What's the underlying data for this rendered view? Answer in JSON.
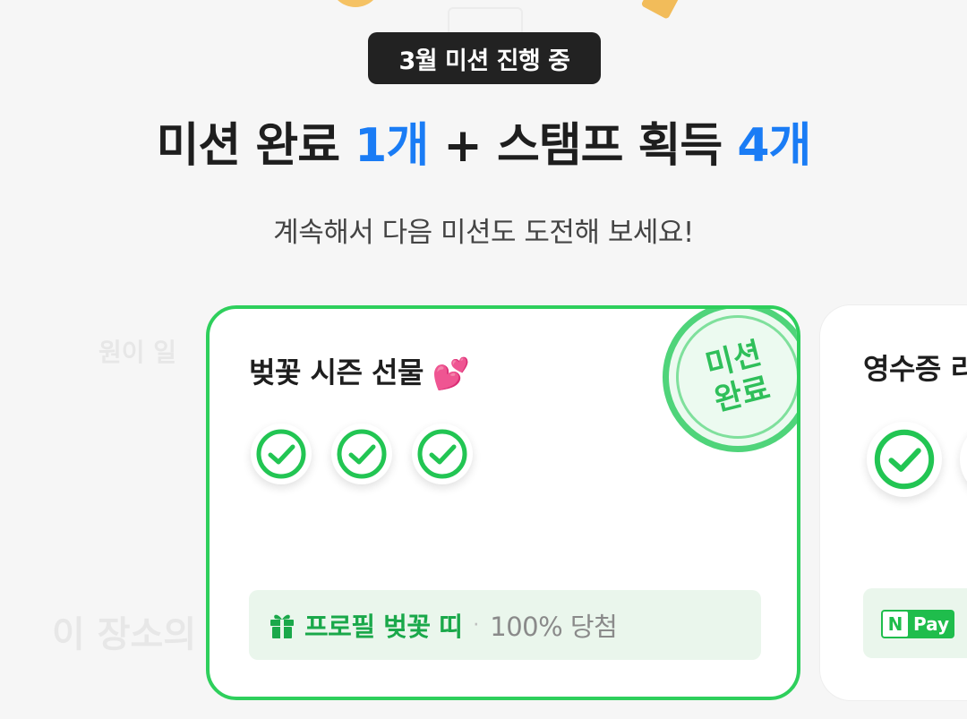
{
  "status_pill": "3월 미션 진행 중",
  "headline": {
    "part1": "미션 완료 ",
    "count1": "1개",
    "part2": " + 스탬프 획득 ",
    "count2": "4개"
  },
  "subtitle": "계속해서 다음 미션도 도전해 보세요!",
  "background_ghost_text": [
    "이 장소의",
    "원이 일"
  ],
  "cards": [
    {
      "title": "벚꽃 시즌 선물",
      "title_emoji": "💕",
      "completed_checks": 3,
      "stamp_lines": [
        "미션",
        "완료"
      ],
      "reward_name": "프로필 벚꽃 띠",
      "reward_separator": "·",
      "reward_probability": "100% 당첨",
      "reward_icon": "gift-icon"
    },
    {
      "title": "영수증 리",
      "reward_badge_n": "N",
      "reward_badge_pay": "Pay"
    }
  ],
  "colors": {
    "accent_blue": "#1a7cf5",
    "success_green": "#2ecf5c",
    "reward_green": "#1aa84a"
  }
}
